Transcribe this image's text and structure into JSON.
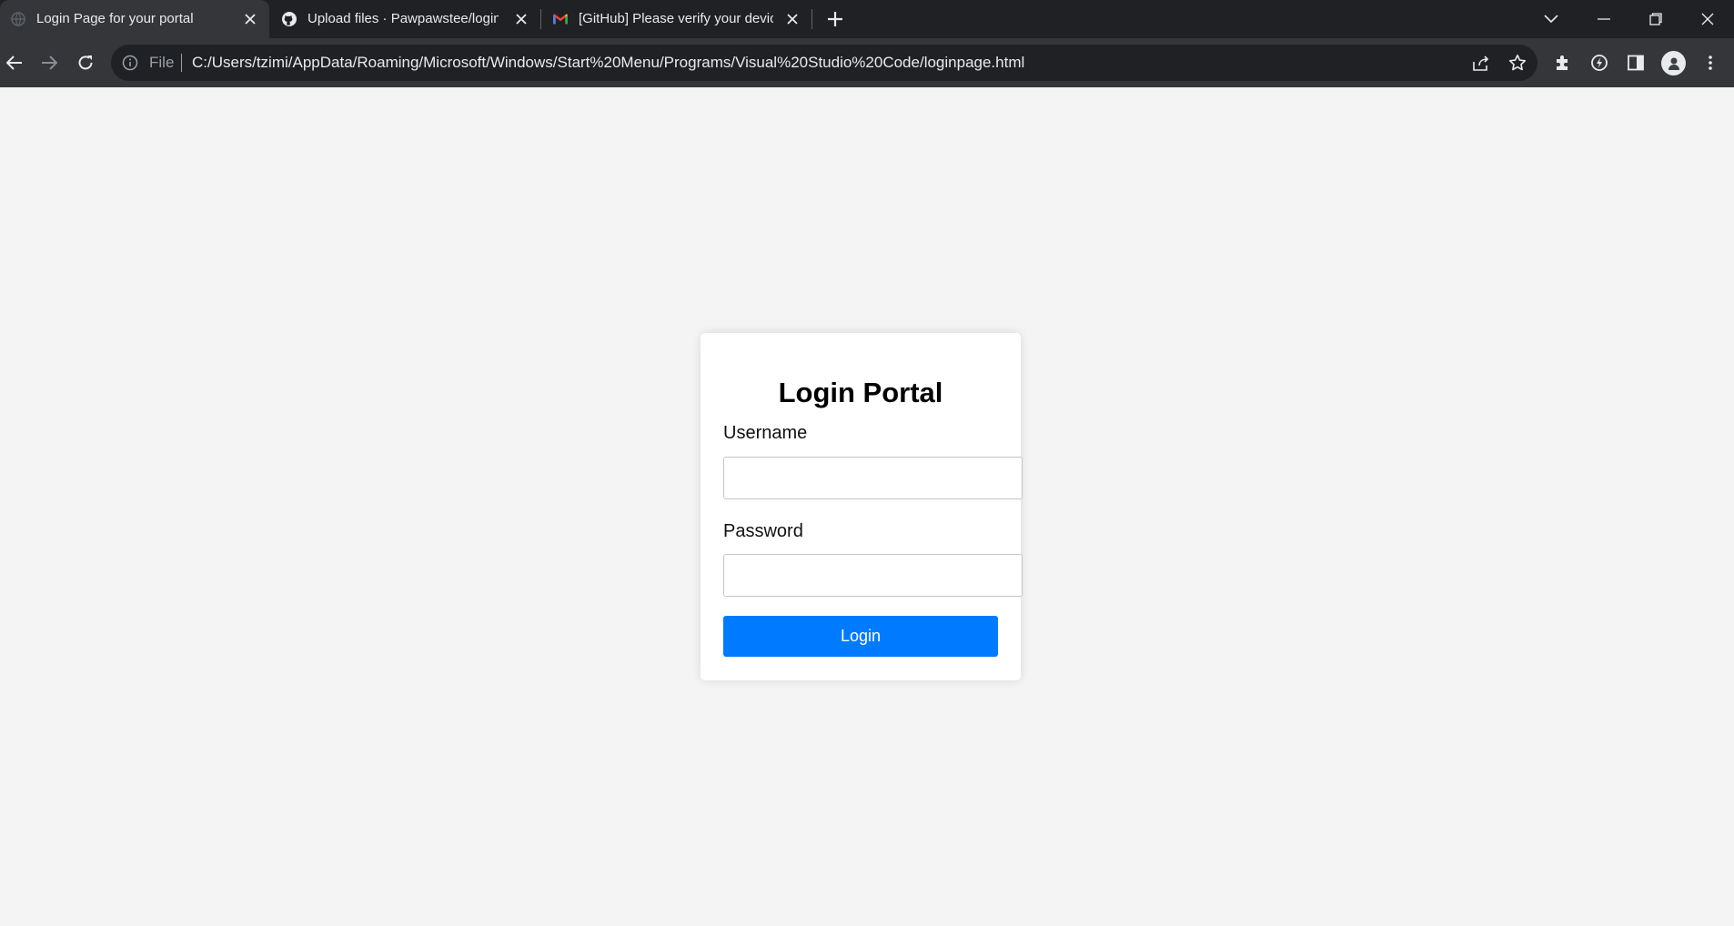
{
  "browser": {
    "tabs": [
      {
        "title": "Login Page for your portal",
        "favicon": "globe-icon",
        "active": true
      },
      {
        "title": "Upload files · Pawpawstee/login",
        "favicon": "github-icon",
        "active": false
      },
      {
        "title": "[GitHub] Please verify your devic",
        "favicon": "gmail-icon",
        "active": false
      }
    ],
    "address_bar": {
      "scheme_label": "File",
      "url": "C:/Users/tzimi/AppData/Roaming/Microsoft/Windows/Start%20Menu/Programs/Visual%20Studio%20Code/loginpage.html"
    }
  },
  "page": {
    "title": "Login Portal",
    "username_label": "Username",
    "username_value": "",
    "password_label": "Password",
    "password_value": "",
    "login_label": "Login"
  },
  "colors": {
    "accent": "#007bff",
    "page_background": "#f4f4f4",
    "tabstrip": "#202124",
    "toolbar": "#35363a"
  }
}
